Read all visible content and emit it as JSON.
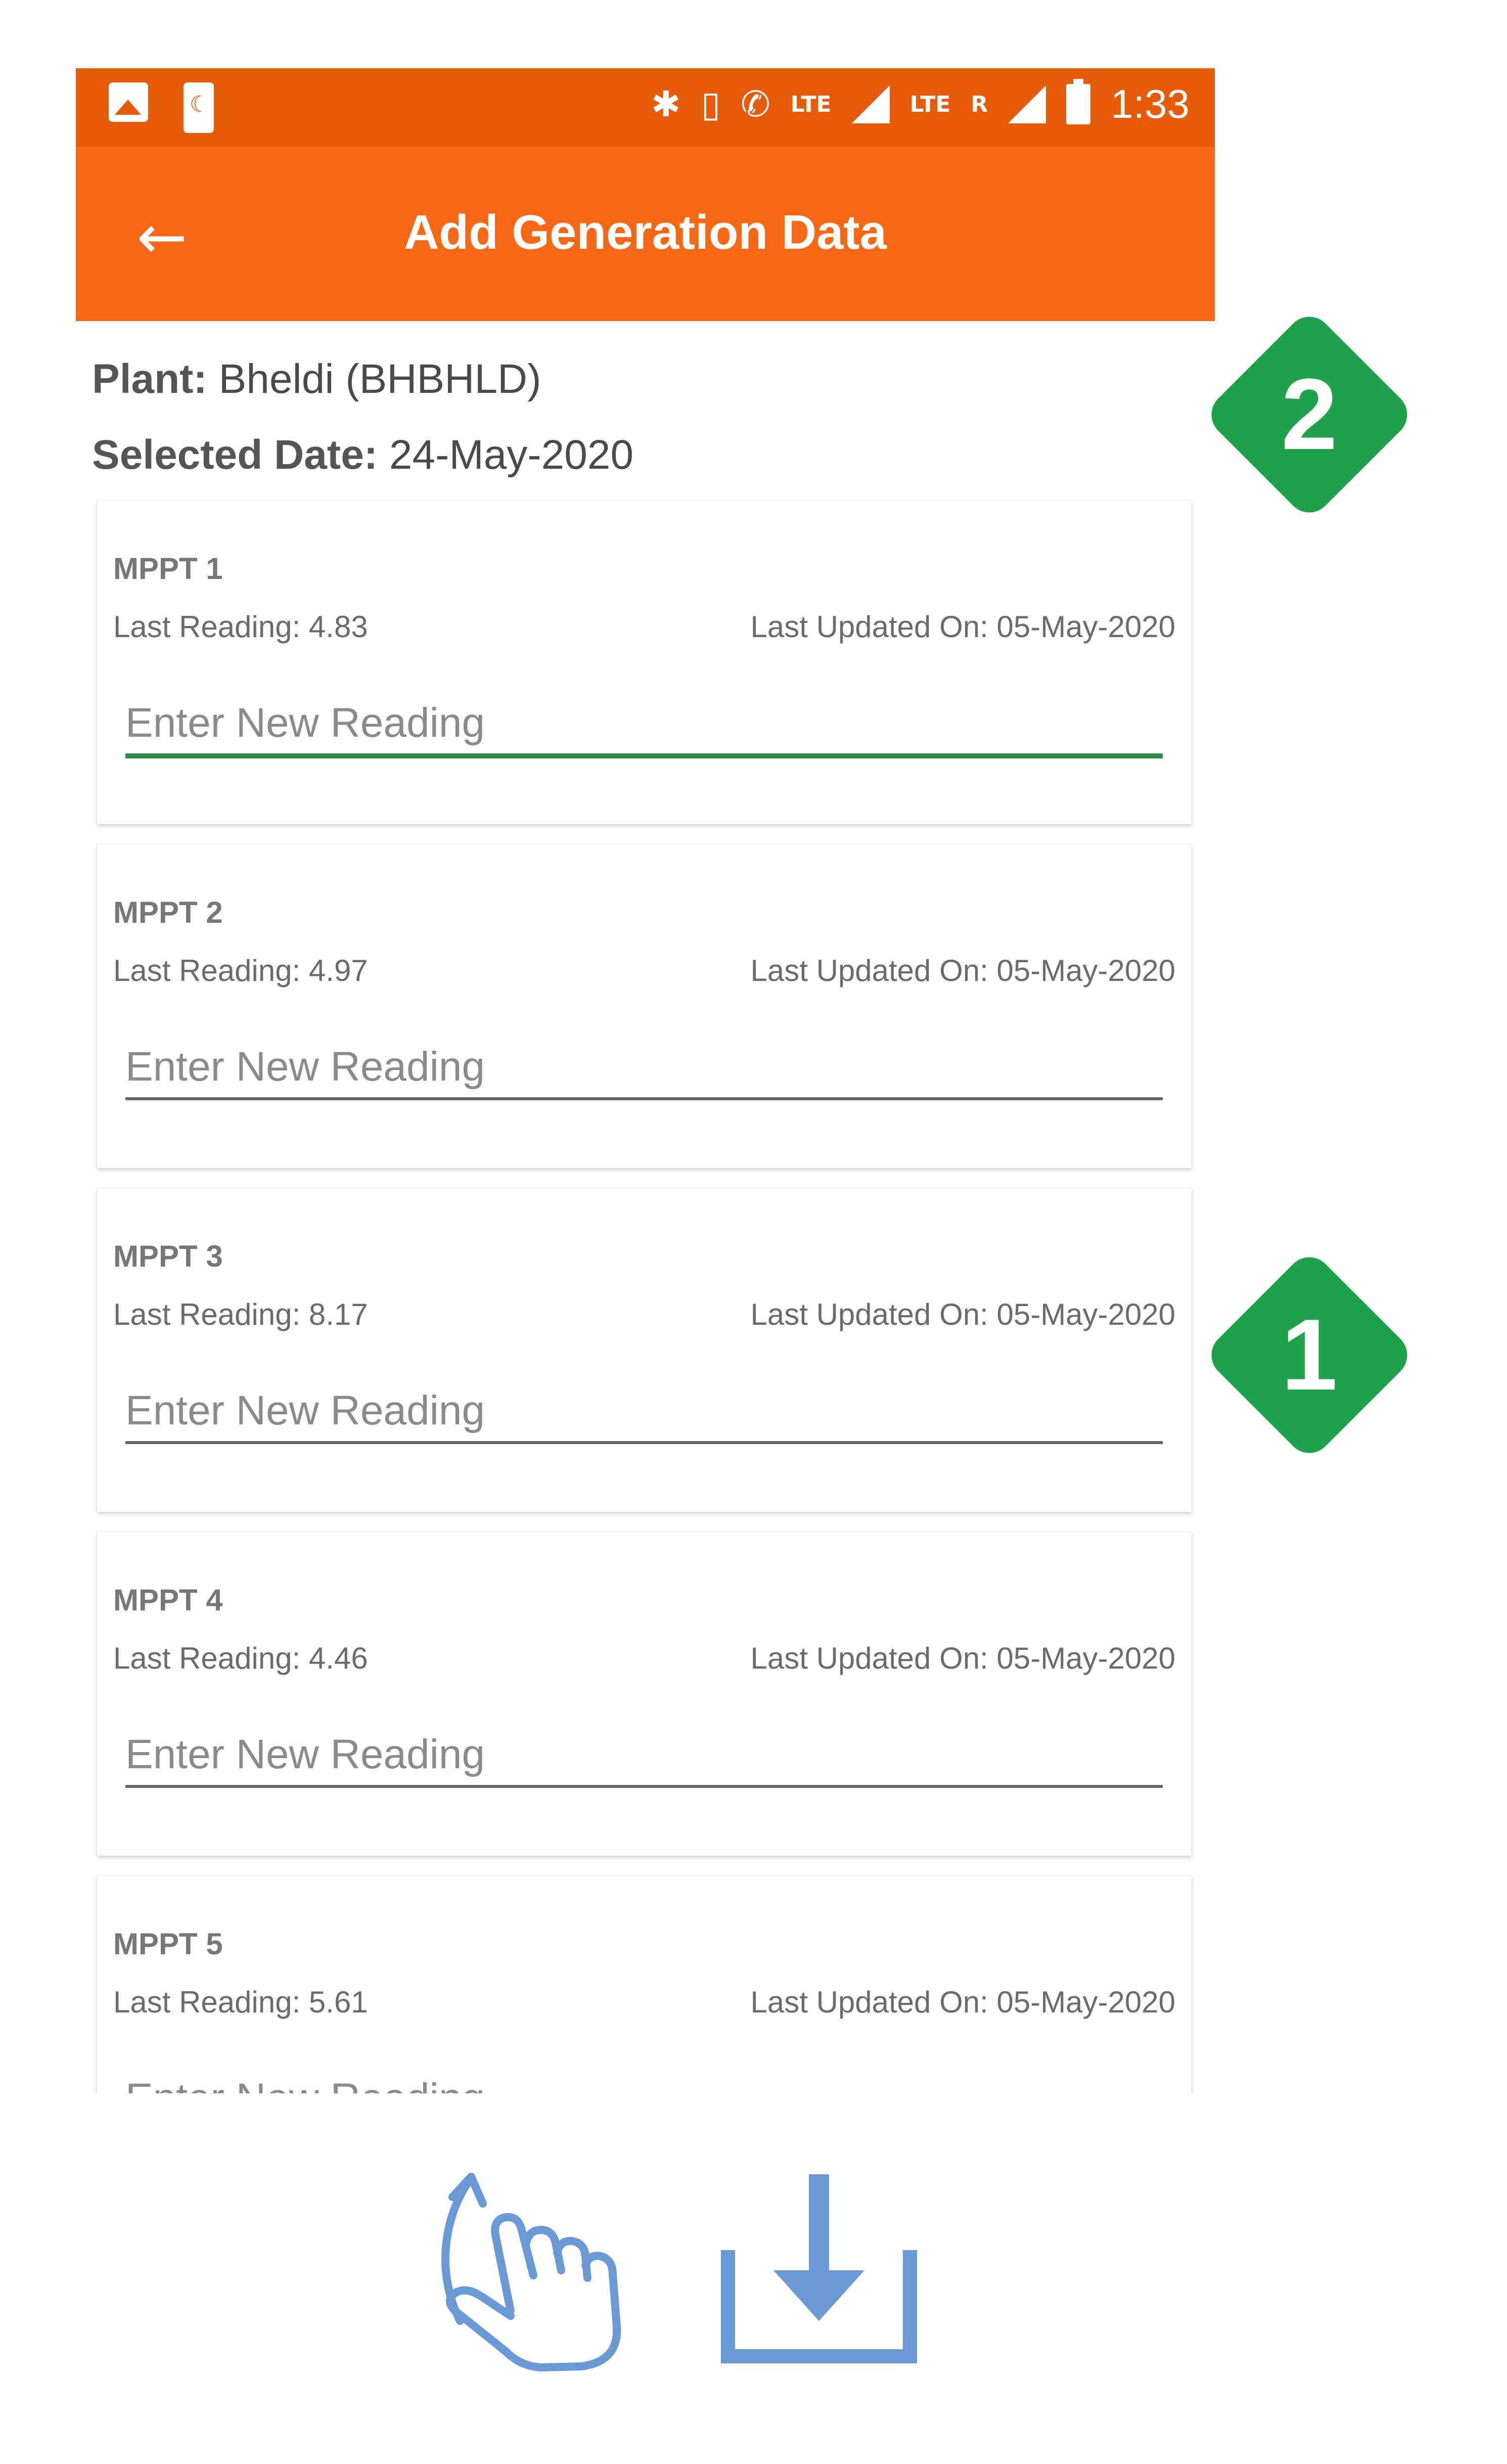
{
  "status_bar": {
    "lte1": "LTE",
    "lte2": "LTE",
    "roaming": "R",
    "time": "1:33",
    "icons": [
      "image-icon",
      "phone-icon",
      "bluetooth-icon",
      "vibrate-icon",
      "volte-call-icon",
      "signal-icon",
      "battery-icon"
    ]
  },
  "app_bar": {
    "title": "Add Generation Data",
    "back_icon": "arrow-left-icon"
  },
  "plant": {
    "label": "Plant:",
    "value": "Bheldi (BHBHLD)"
  },
  "selected_date": {
    "label": "Selected Date:",
    "value": "24-May-2020"
  },
  "cards": [
    {
      "title": "MPPT 1",
      "last_reading": "Last Reading: 4.83",
      "updated": "Last Updated On: 05-May-2020",
      "placeholder": "Enter New Reading"
    },
    {
      "title": "MPPT 2",
      "last_reading": "Last Reading: 4.97",
      "updated": "Last Updated On: 05-May-2020",
      "placeholder": "Enter New Reading"
    },
    {
      "title": "MPPT 3",
      "last_reading": "Last Reading: 8.17",
      "updated": "Last Updated On: 05-May-2020",
      "placeholder": "Enter New Reading"
    },
    {
      "title": "MPPT 4",
      "last_reading": "Last Reading: 4.46",
      "updated": "Last Updated On: 05-May-2020",
      "placeholder": "Enter New Reading"
    },
    {
      "title": "MPPT 5",
      "last_reading": "Last Reading: 5.61",
      "updated": "Last Updated On: 05-May-2020",
      "placeholder": "Enter New Reading"
    }
  ],
  "badges": {
    "first": "2",
    "second": "1"
  },
  "colors": {
    "status_bar": "#E65A0A",
    "app_bar": "#F86714",
    "badge": "#1EA24A",
    "focus_underline": "#2E8B45",
    "icon_blue": "#6A9AD6"
  },
  "bottom_icons": [
    "swipe-up-hand-icon",
    "download-icon"
  ]
}
